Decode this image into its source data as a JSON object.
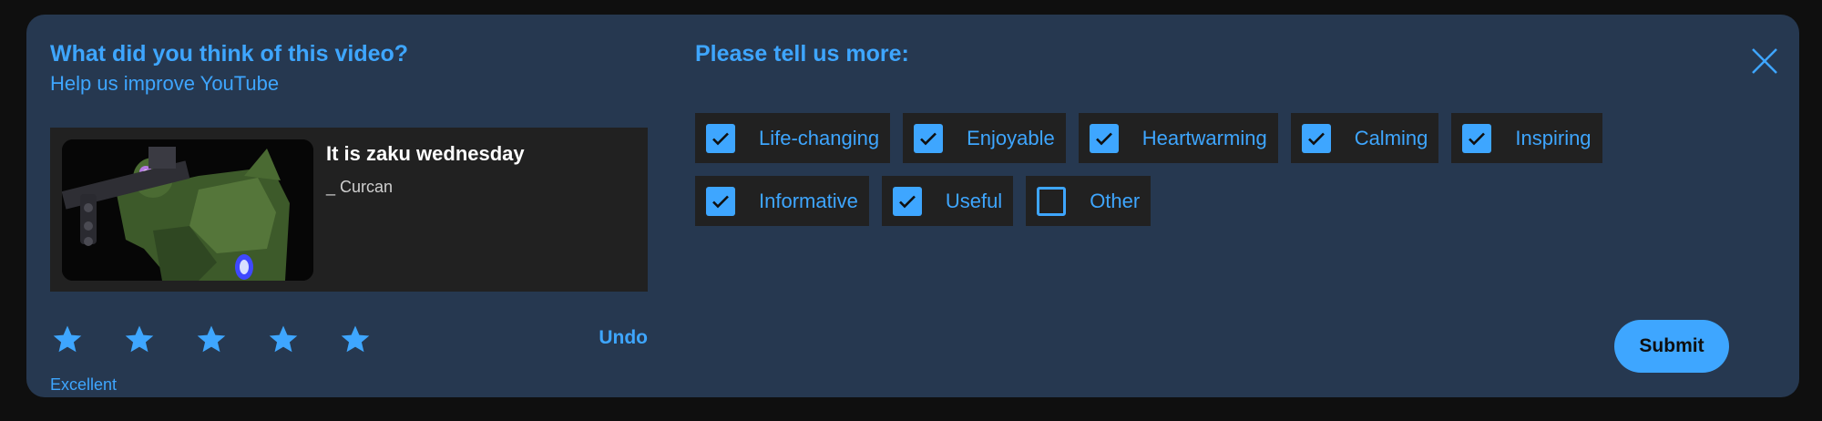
{
  "dialog": {
    "question_title": "What did you think of this video?",
    "question_subtitle": "Help us improve YouTube",
    "more_title": "Please tell us more:",
    "close_icon": "close-icon",
    "accent_color": "#3ea6ff",
    "background_color": "#263850"
  },
  "video": {
    "title": "It is zaku wednesday",
    "channel": "_ Curcan",
    "thumbnail": "thumbnail-image"
  },
  "rating": {
    "stars_filled": 5,
    "stars_total": 5,
    "star_icon": "star-icon",
    "label": "Excellent",
    "undo_label": "Undo"
  },
  "reasons": [
    {
      "label": "Life-changing",
      "checked": true
    },
    {
      "label": "Enjoyable",
      "checked": true
    },
    {
      "label": "Heartwarming",
      "checked": true
    },
    {
      "label": "Calming",
      "checked": true
    },
    {
      "label": "Inspiring",
      "checked": true
    },
    {
      "label": "Informative",
      "checked": true
    },
    {
      "label": "Useful",
      "checked": true
    },
    {
      "label": "Other",
      "checked": false
    }
  ],
  "actions": {
    "submit_label": "Submit"
  }
}
